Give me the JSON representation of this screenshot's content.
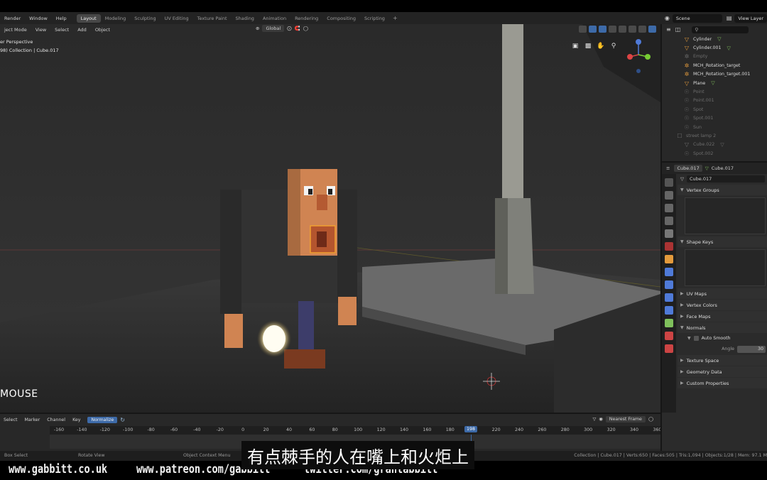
{
  "menubar": {
    "menus": [
      "Render",
      "Window",
      "Help"
    ],
    "workspaces": [
      "Layout",
      "Modeling",
      "Sculpting",
      "UV Editing",
      "Texture Paint",
      "Shading",
      "Animation",
      "Rendering",
      "Compositing",
      "Scripting"
    ],
    "active_workspace": "Layout",
    "add_tab": "+",
    "scene": "Scene",
    "view_layer": "View Layer"
  },
  "viewport": {
    "mode": "ject Mode",
    "menus": [
      "View",
      "Select",
      "Add",
      "Object"
    ],
    "orientation": "Global",
    "view_name": "er Perspective",
    "collection_info": "98) Collection | Cube.017",
    "mouse_label": "MOUSE"
  },
  "outliner": {
    "items": [
      {
        "name": "Cylinder",
        "dim": false,
        "icon": "mesh-icon"
      },
      {
        "name": "Cylinder.001",
        "dim": false,
        "icon": "mesh-icon"
      },
      {
        "name": "Empty",
        "dim": true,
        "icon": "empty-icon"
      },
      {
        "name": "MCH_Rotation_target",
        "dim": false,
        "icon": "empty-icon"
      },
      {
        "name": "MCH_Rotation_target.001",
        "dim": false,
        "icon": "empty-icon"
      },
      {
        "name": "Plane",
        "dim": false,
        "icon": "mesh-icon"
      },
      {
        "name": "Point",
        "dim": true,
        "icon": "light-icon"
      },
      {
        "name": "Point.001",
        "dim": true,
        "icon": "light-icon"
      },
      {
        "name": "Spot",
        "dim": true,
        "icon": "light-icon"
      },
      {
        "name": "Spot.001",
        "dim": true,
        "icon": "light-icon"
      },
      {
        "name": "Sun",
        "dim": true,
        "icon": "light-icon"
      },
      {
        "name": "street lamp 2",
        "dim": true,
        "icon": "collection-icon"
      },
      {
        "name": "Cube.022",
        "dim": true,
        "icon": "mesh-icon"
      },
      {
        "name": "Spot.002",
        "dim": true,
        "icon": "light-icon"
      }
    ]
  },
  "properties": {
    "object_name": "Cube.017",
    "mesh_name": "Cube.017",
    "data_name": "Cube.017",
    "panels": {
      "vertex_groups": "Vertex Groups",
      "shape_keys": "Shape Keys",
      "uv_maps": "UV Maps",
      "vertex_colors": "Vertex Colors",
      "face_maps": "Face Maps",
      "normals": "Normals",
      "auto_smooth": "Auto Smooth",
      "angle_label": "Angle",
      "angle_value": "30",
      "texture_space": "Texture Space",
      "geometry_data": "Geometry Data",
      "custom_properties": "Custom Properties"
    }
  },
  "timeline": {
    "menus": [
      "Select",
      "Marker",
      "Channel",
      "Key"
    ],
    "normalize": "Normalize",
    "interp": "Nearest Frame",
    "current_frame": "198",
    "ticks": [
      "-160",
      "-140",
      "-120",
      "-100",
      "-80",
      "-60",
      "-40",
      "-20",
      "0",
      "20",
      "40",
      "60",
      "80",
      "100",
      "120",
      "140",
      "160",
      "180",
      "220",
      "240",
      "260",
      "280",
      "300",
      "320",
      "340",
      "360"
    ]
  },
  "statusbar": {
    "left": "Box Select",
    "middle": "Rotate View",
    "right_action": "Object Context Menu",
    "stats": "Collection | Cube.017 | Verts:650 | Faces:505 | Tris:1,094 | Objects:1/28 | Mem: 97.1 M"
  },
  "watermark": {
    "site": "www.gabbitt.co.uk",
    "patreon": "www.patreon.com/gabbitt",
    "twitter": "twitter.com/grantabbitt"
  },
  "subtitle": "有点棘手的人在嘴上和火炬上",
  "colors": {
    "accent_blue": "#3d6aa8",
    "mesh_orange": "#e39a3c",
    "data_green": "#7fc05c"
  }
}
